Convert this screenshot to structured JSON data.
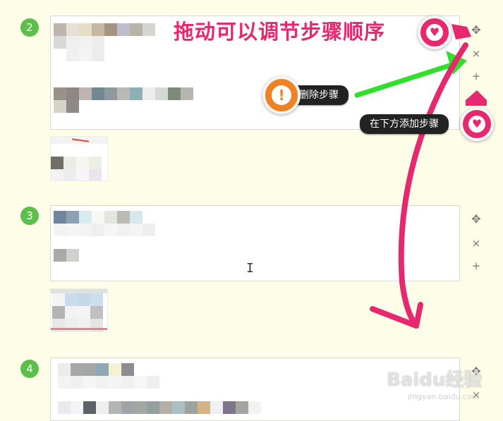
{
  "steps": [
    {
      "number": "2"
    },
    {
      "number": "3"
    },
    {
      "number": "4"
    }
  ],
  "controls": {
    "move": "✥",
    "delete": "×",
    "add": "+"
  },
  "annotations": {
    "title": "拖动可以调节步骤顺序",
    "delete_tip": "删除步骤",
    "add_tip": "在下方添加步骤",
    "warn_symbol": "!",
    "heart_symbol": "♥"
  },
  "watermark": {
    "main": "Baidu经验",
    "sub": "jingyan.baidu.com"
  },
  "colors": {
    "background": "#fdfde8",
    "step_badge": "#5bbf4a",
    "annotation_pink": "#e6286e",
    "annotation_green": "#2ee02a",
    "warn_orange": "#f08226"
  }
}
